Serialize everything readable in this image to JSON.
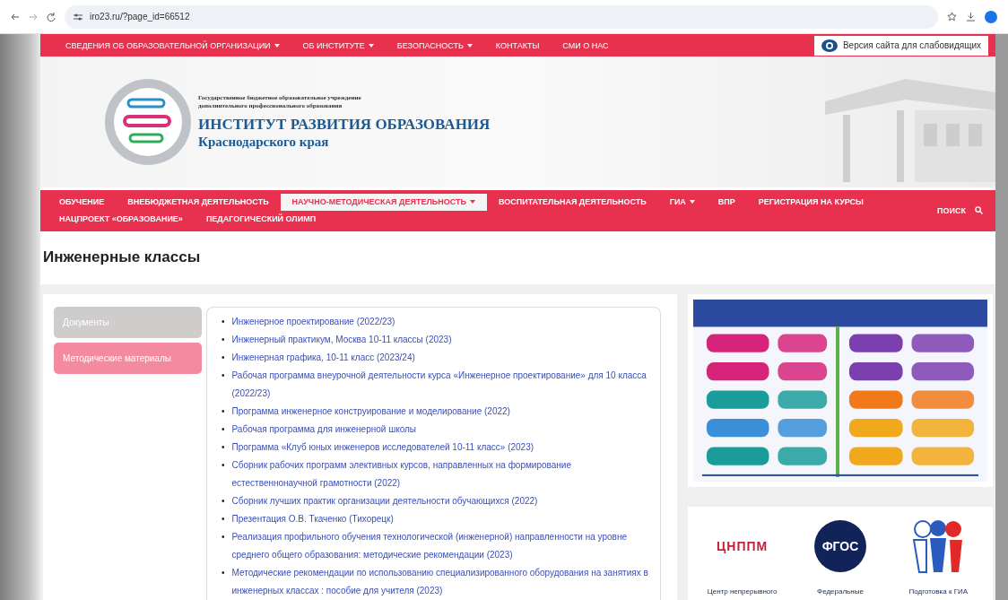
{
  "browser": {
    "url": "iro23.ru/?page_id=66512"
  },
  "top_menu": [
    {
      "label": "СВЕДЕНИЯ ОБ ОБРАЗОВАТЕЛЬНОЙ ОРГАНИЗАЦИИ",
      "dropdown": true
    },
    {
      "label": "ОБ ИНСТИТУТЕ",
      "dropdown": true
    },
    {
      "label": "БЕЗОПАСНОСТЬ",
      "dropdown": true
    },
    {
      "label": "КОНТАКТЫ",
      "dropdown": false
    },
    {
      "label": "СМИ О НАС",
      "dropdown": false
    }
  ],
  "accessibility_link": "Версия сайта для слабовидящих",
  "header": {
    "subtitle_line_1": "Государственное бюджетное образовательное учреждение",
    "subtitle_line_2": "дополнительного профессионального образования",
    "title": "ИНСТИТУТ РАЗВИТИЯ ОБРАЗОВАНИЯ",
    "title_line_2": "Краснодарского края"
  },
  "nav": [
    {
      "label": "ОБУЧЕНИЕ",
      "dropdown": false,
      "selected": false
    },
    {
      "label": "ВНЕБЮДЖЕТНАЯ ДЕЯТЕЛЬНОСТЬ",
      "dropdown": false,
      "selected": false
    },
    {
      "label": "НАУЧНО-МЕТОДИЧЕСКАЯ ДЕЯТЕЛЬНОСТЬ",
      "dropdown": true,
      "selected": true
    },
    {
      "label": "ВОСПИТАТЕЛЬНАЯ ДЕЯТЕЛЬНОСТЬ",
      "dropdown": false,
      "selected": false
    },
    {
      "label": "ГИА",
      "dropdown": true,
      "selected": false
    },
    {
      "label": "ВПР",
      "dropdown": false,
      "selected": false
    },
    {
      "label": "РЕГИСТРАЦИЯ НА КУРСЫ",
      "dropdown": false,
      "selected": false
    },
    {
      "label": "НАЦПРОЕКТ «ОБРАЗОВАНИЕ»",
      "dropdown": false,
      "selected": false
    },
    {
      "label": "ПЕДАГОГИЧЕСКИЙ ОЛИМП",
      "dropdown": false,
      "selected": false
    }
  ],
  "search_label": "ПОИСК",
  "page_title": "Инженерные классы",
  "side_tabs": [
    {
      "label": "Документы",
      "selected": false
    },
    {
      "label": "Методические материалы",
      "selected": true
    }
  ],
  "links": [
    {
      "bullet": "•",
      "text": "Инженерное проектирование (2022/23)"
    },
    {
      "bullet": "•",
      "text": "Инженерный практикум, Москва 10-11 классы (2023)"
    },
    {
      "bullet": "•",
      "text": "Инженерная графика, 10-11 класс (2023/24)"
    },
    {
      "bullet": "•",
      "text": "Рабочая программа внеурочной деятельности курса «Инженерное проектирование» для 10 класса (2022/23)"
    },
    {
      "bullet": "•",
      "text": "Программа инженерное конструирование и моделирование (2022)"
    },
    {
      "bullet": "•",
      "text": "Рабочая программа для инженерной школы"
    },
    {
      "bullet": "•",
      "text": "Программа «Клуб юных инженеров исследователей 10-11 класс» (2023)"
    },
    {
      "bullet": "•",
      "text": "Сборник рабочих программ элективных курсов, направленных на формирование естественнонаучной грамотности (2022)"
    },
    {
      "bullet": "•",
      "text": "Сборник лучших практик организации деятельности обучающихся (2022)"
    },
    {
      "bullet": "•",
      "text": "Презентация О.В. Ткаченко (Тихорецк)"
    },
    {
      "bullet": "•",
      "text": "Реализация профильного обучения технологической (инженерной) направленности на уровне среднего общего образования: методические рекомендации (2023)"
    },
    {
      "bullet": "•",
      "text": "Методические рекомендации по использованию специализированного оборудования на занятиях в инженерных классах : пособие для учителя (2023)"
    }
  ],
  "partners": [
    {
      "kind": "wordmark",
      "logo_text": "ЦНППМ",
      "caption": "Центр непрерывного"
    },
    {
      "kind": "circle",
      "logo_text": "ФГОС",
      "caption": "Федеральные"
    },
    {
      "kind": "figures",
      "caption": "Подготовка к ГИА"
    }
  ]
}
